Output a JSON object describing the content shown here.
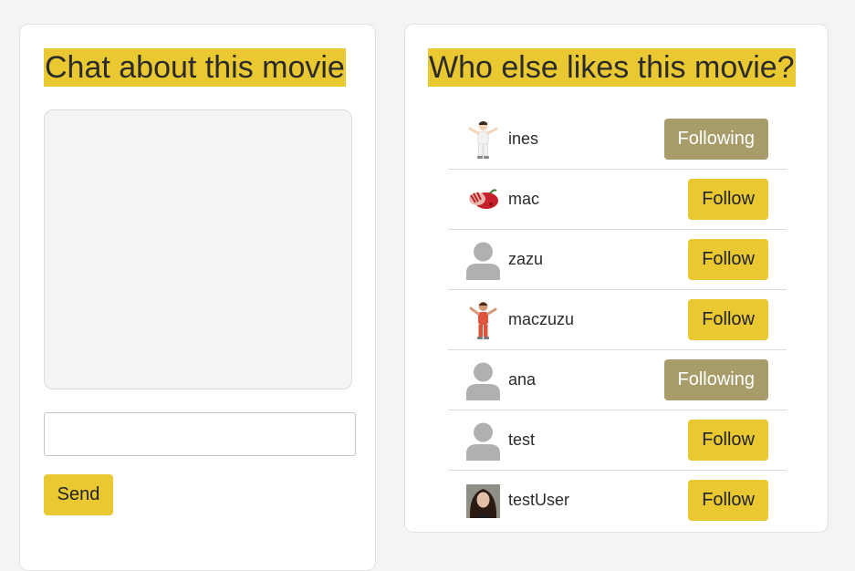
{
  "chat": {
    "title": "Chat about this movie",
    "input_value": "",
    "input_placeholder": "",
    "send_label": "Send"
  },
  "users_panel": {
    "title": "Who else likes this movie?",
    "users": [
      {
        "name": "ines",
        "button_label": "Following",
        "following": true,
        "avatar_icon": "person-white-outfit-icon"
      },
      {
        "name": "mac",
        "button_label": "Follow",
        "following": false,
        "avatar_icon": "red-food-icon"
      },
      {
        "name": "zazu",
        "button_label": "Follow",
        "following": false,
        "avatar_icon": "default-user-icon"
      },
      {
        "name": "maczuzu",
        "button_label": "Follow",
        "following": false,
        "avatar_icon": "person-red-outfit-icon"
      },
      {
        "name": "ana",
        "button_label": "Following",
        "following": true,
        "avatar_icon": "default-user-icon"
      },
      {
        "name": "test",
        "button_label": "Follow",
        "following": false,
        "avatar_icon": "default-user-icon"
      },
      {
        "name": "testUser",
        "button_label": "Follow",
        "following": false,
        "avatar_icon": "photo-portrait-icon"
      }
    ]
  },
  "colors": {
    "page_bg": "#f4f4f4",
    "accent": "#e9c832",
    "following_bg": "#a89c6a"
  }
}
